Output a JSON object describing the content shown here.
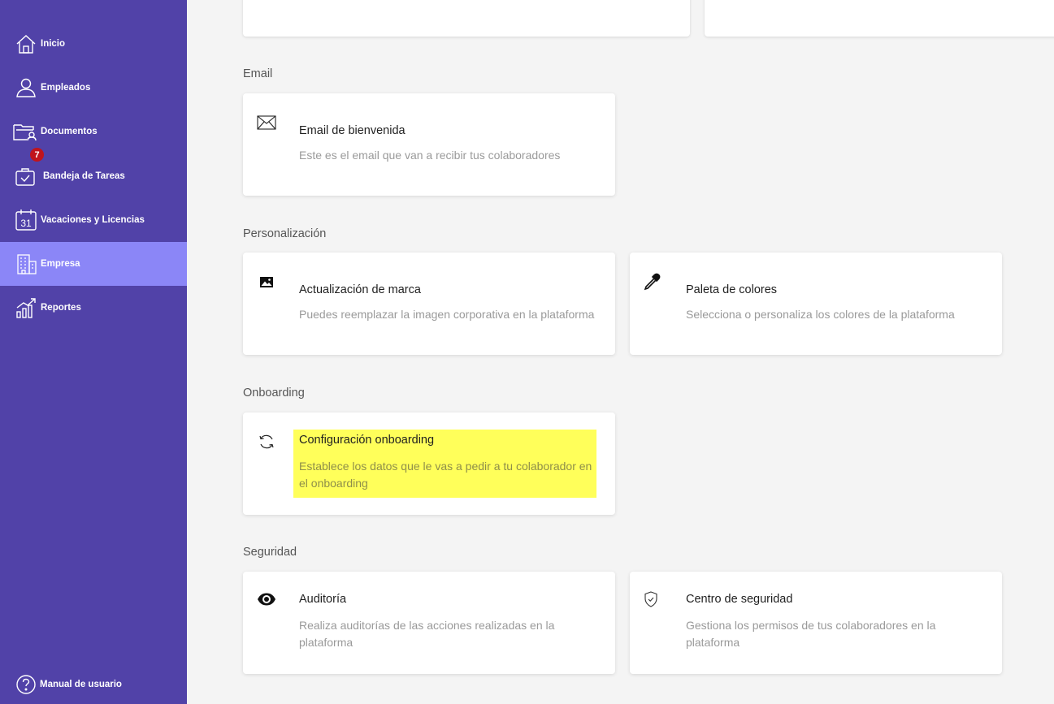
{
  "sidebar": {
    "items": [
      {
        "label": "Inicio",
        "icon": "home-icon"
      },
      {
        "label": "Empleados",
        "icon": "user-icon"
      },
      {
        "label": "Documentos",
        "icon": "folder-user-icon"
      },
      {
        "label": "Bandeja de Tareas",
        "icon": "task-bag-icon",
        "badge": "7"
      },
      {
        "label": "Vacaciones y Licencias",
        "icon": "calendar-icon",
        "calendar_day": "31"
      },
      {
        "label": "Empresa",
        "icon": "building-icon",
        "active": true
      },
      {
        "label": "Reportes",
        "icon": "chart-icon"
      }
    ],
    "help_label": "Manual de usuario",
    "colors": {
      "background": "#5142a8",
      "active": "#8b86f7",
      "badge": "#c0141c"
    }
  },
  "sections": {
    "email": {
      "title": "Email",
      "cards": [
        {
          "icon": "envelope-icon",
          "title": "Email de bienvenida",
          "description": "Este es el email que van a recibir tus colaboradores"
        }
      ]
    },
    "personalizacion": {
      "title": "Personalización",
      "cards": [
        {
          "icon": "image-icon",
          "title": "Actualización de marca",
          "description": "Puedes reemplazar la imagen corporativa en la plataforma"
        },
        {
          "icon": "eyedropper-icon",
          "title": "Paleta de colores",
          "description": "Selecciona o personaliza los colores de la plataforma"
        }
      ]
    },
    "onboarding": {
      "title": "Onboarding",
      "cards": [
        {
          "icon": "refresh-icon",
          "title": "Configuración onboarding",
          "description_line1": "Establece los datos que le vas a pedir a tu colaborador en",
          "description_line2": "el onboarding",
          "highlighted": true
        }
      ]
    },
    "seguridad": {
      "title": "Seguridad",
      "cards": [
        {
          "icon": "eye-icon",
          "title": "Auditoría",
          "description_line1": "Realiza auditorías de las acciones realizadas en la",
          "description_line2": "plataforma"
        },
        {
          "icon": "shield-check-icon",
          "title": "Centro de seguridad",
          "description_line1": "Gestiona los permisos de tus colaboradores en la",
          "description_line2": "plataforma"
        }
      ]
    }
  },
  "highlight_color": "#ffff5a"
}
